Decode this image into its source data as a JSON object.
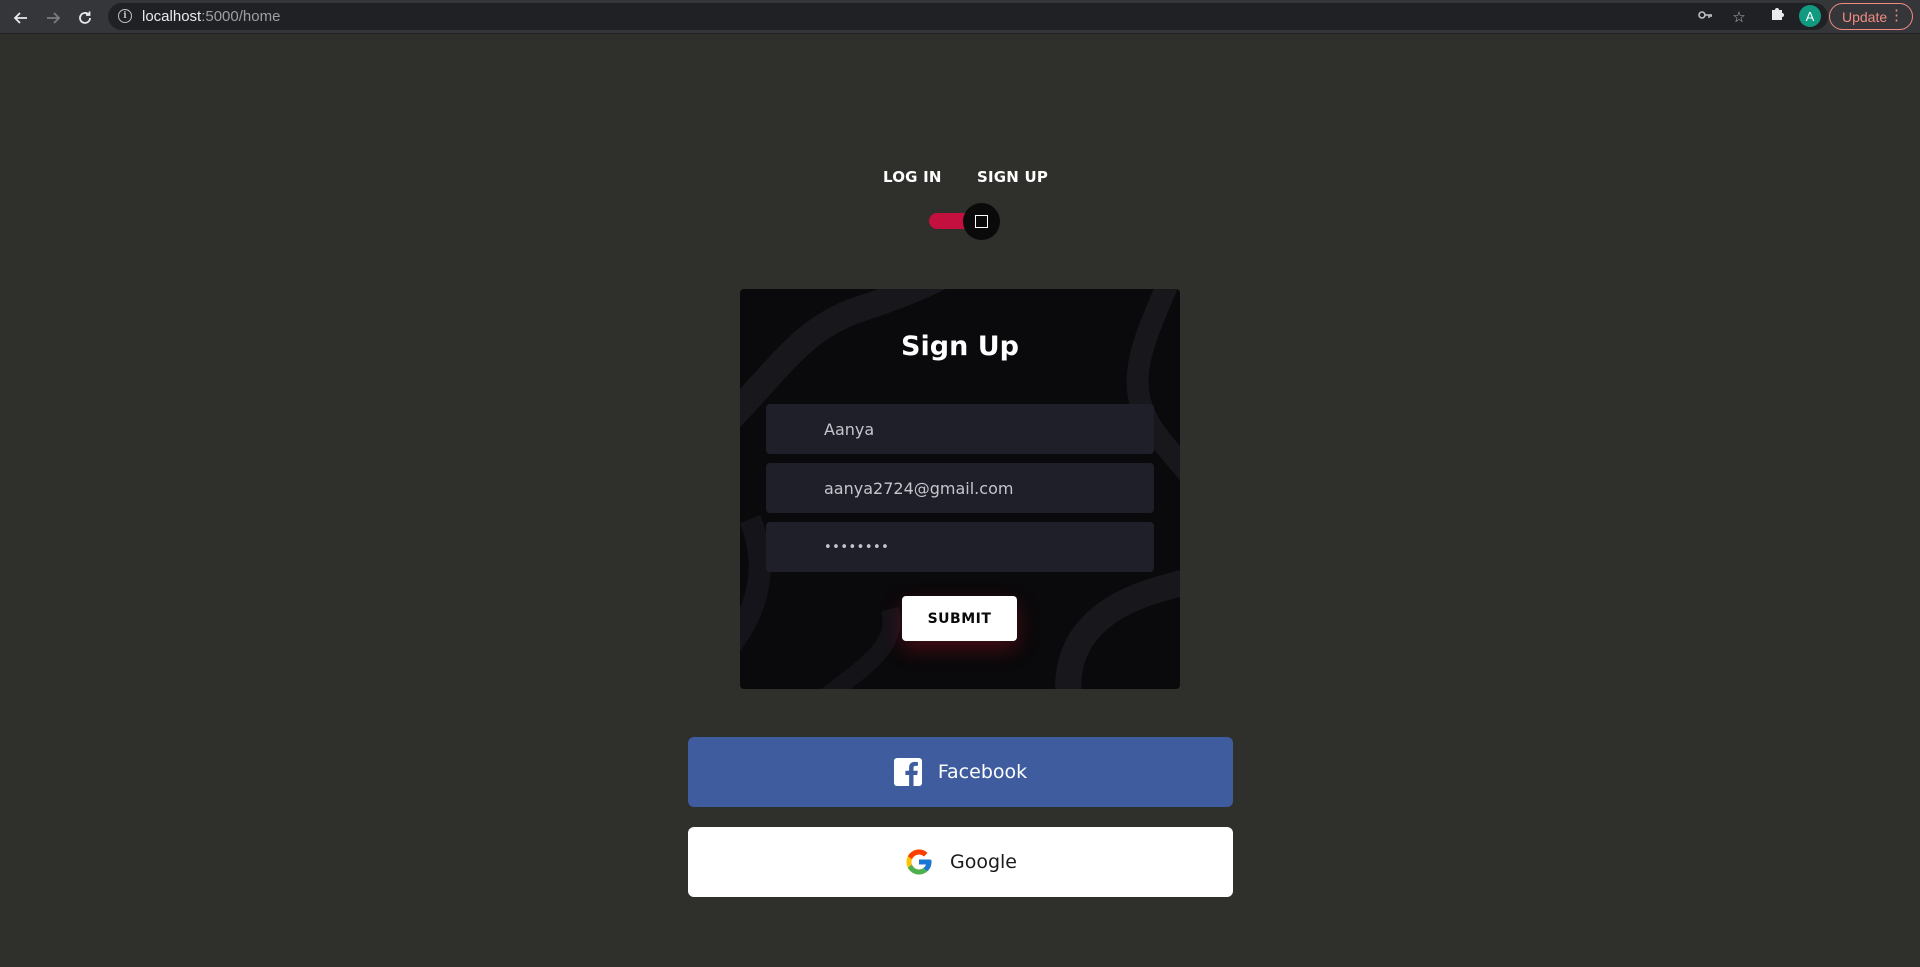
{
  "browser": {
    "url_host": "localhost",
    "url_path": ":5000/home",
    "update_label": "Update",
    "profile_initial": "A",
    "icons": {
      "back": "arrow-left-icon",
      "forward": "arrow-right-icon",
      "reload": "reload-icon",
      "site_info": "info-icon",
      "password": "key-icon",
      "bookmark": "star-icon",
      "extensions": "puzzle-icon",
      "menu": "more-vert-icon"
    }
  },
  "auth_switch": {
    "login_label": "LOG IN",
    "signup_label": "SIGN UP",
    "checked": true,
    "track_color": "#c4103f"
  },
  "form": {
    "title": "Sign Up",
    "name_value": "Aanya",
    "email_value": "aanya2724@gmail.com",
    "password_value": "••••••••",
    "submit_label": "SUBMIT"
  },
  "social": {
    "facebook_label": "Facebook",
    "facebook_color": "#3f5d9e",
    "facebook_icon": "facebook-icon",
    "google_label": "Google",
    "google_icon": "google-icon"
  },
  "colors": {
    "page_bg": "#2f2f2b",
    "card_bg": "#0a090b",
    "input_bg": "#1f1f29"
  }
}
